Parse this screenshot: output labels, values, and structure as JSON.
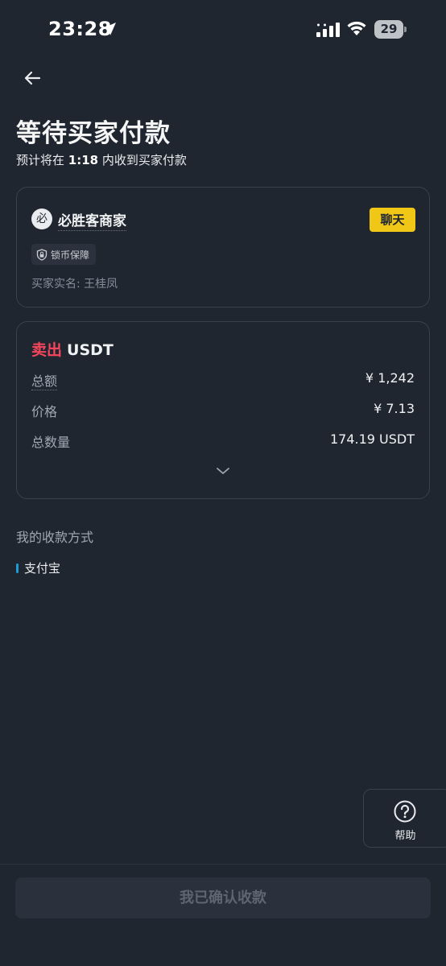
{
  "status_bar": {
    "time": "23:28",
    "battery": "29"
  },
  "header": {
    "title": "等待买家付款",
    "subtitle_prefix": "预计将在 ",
    "countdown": "1:18",
    "subtitle_suffix": " 内收到买家付款"
  },
  "merchant": {
    "avatar_char": "必",
    "name": "必胜客商家",
    "chat_label": "聊天",
    "badge_label": "锁币保障",
    "real_name": "买家实名: 王桂凤"
  },
  "order": {
    "side": "卖出",
    "asset": "USDT",
    "rows": [
      {
        "label": "总额",
        "value": "¥ 1,242"
      },
      {
        "label": "价格",
        "value": "¥ 7.13"
      },
      {
        "label": "总数量",
        "value": "174.19 USDT"
      }
    ]
  },
  "payment": {
    "section_label": "我的收款方式",
    "method": "支付宝",
    "method_color": "#1c9bd8"
  },
  "help": {
    "label": "帮助"
  },
  "confirm": {
    "label": "我已确认收款"
  },
  "colors": {
    "accent": "#f0c716",
    "sell": "#f6465d",
    "background": "#1f2630"
  }
}
